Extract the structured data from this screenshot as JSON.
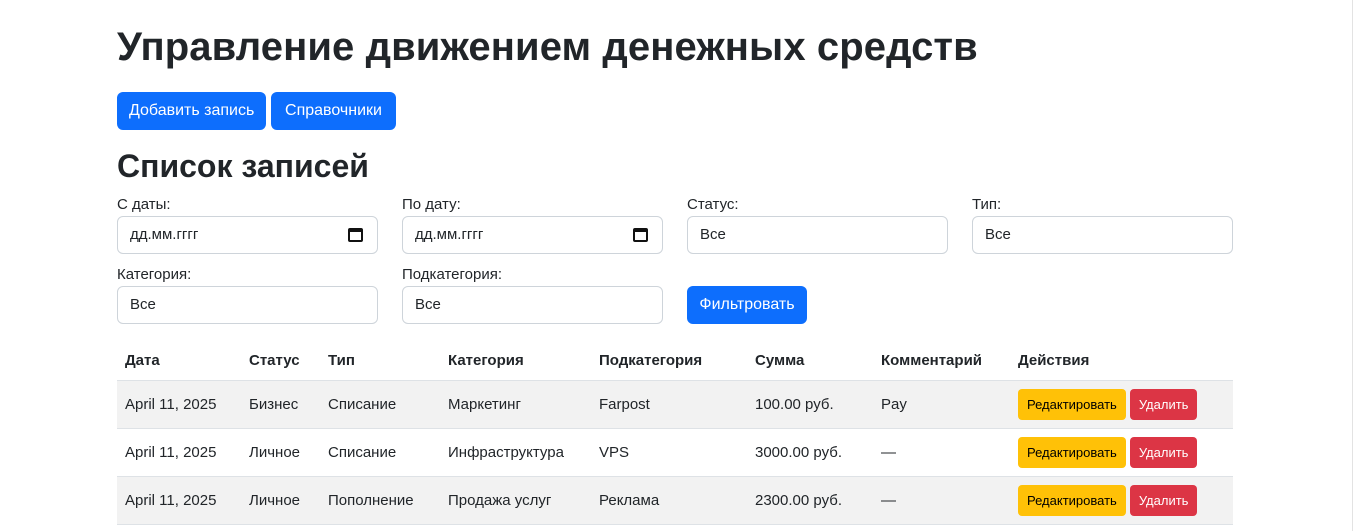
{
  "page": {
    "title": "Управление движением денежных средств"
  },
  "toolbar": {
    "add_label": "Добавить запись",
    "references_label": "Справочники"
  },
  "section": {
    "title": "Список записей"
  },
  "filters": {
    "date_from": {
      "label": "С даты:",
      "value": "дд.мм.гггг"
    },
    "date_to": {
      "label": "По дату:",
      "value": "дд.мм.гггг"
    },
    "status": {
      "label": "Статус:",
      "value": "Все"
    },
    "type": {
      "label": "Тип:",
      "value": "Все"
    },
    "category": {
      "label": "Категория:",
      "value": "Все"
    },
    "subcategory": {
      "label": "Подкатегория:",
      "value": "Все"
    },
    "filter_button": "Фильтровать"
  },
  "table": {
    "headers": [
      "Дата",
      "Статус",
      "Тип",
      "Категория",
      "Подкатегория",
      "Сумма",
      "Комментарий",
      "Действия"
    ],
    "rows": [
      {
        "date": "April 11, 2025",
        "status": "Бизнес",
        "type": "Списание",
        "category": "Маркетинг",
        "subcategory": "Farpost",
        "amount": "100.00 руб.",
        "comment": "Pay",
        "edit": "Редактировать",
        "delete": "Удалить"
      },
      {
        "date": "April 11, 2025",
        "status": "Личное",
        "type": "Списание",
        "category": "Инфраструктура",
        "subcategory": "VPS",
        "amount": "3000.00 руб.",
        "comment": "—",
        "edit": "Редактировать",
        "delete": "Удалить"
      },
      {
        "date": "April 11, 2025",
        "status": "Личное",
        "type": "Пополнение",
        "category": "Продажа услуг",
        "subcategory": "Реклама",
        "amount": "2300.00 руб.",
        "comment": "—",
        "edit": "Редактировать",
        "delete": "Удалить"
      }
    ]
  },
  "colors": {
    "primary": "#0d6efd",
    "warning": "#ffc107",
    "danger": "#dc3545",
    "stripe": "#f2f2f2"
  },
  "icons": {
    "date_picker": "calendar-icon"
  }
}
